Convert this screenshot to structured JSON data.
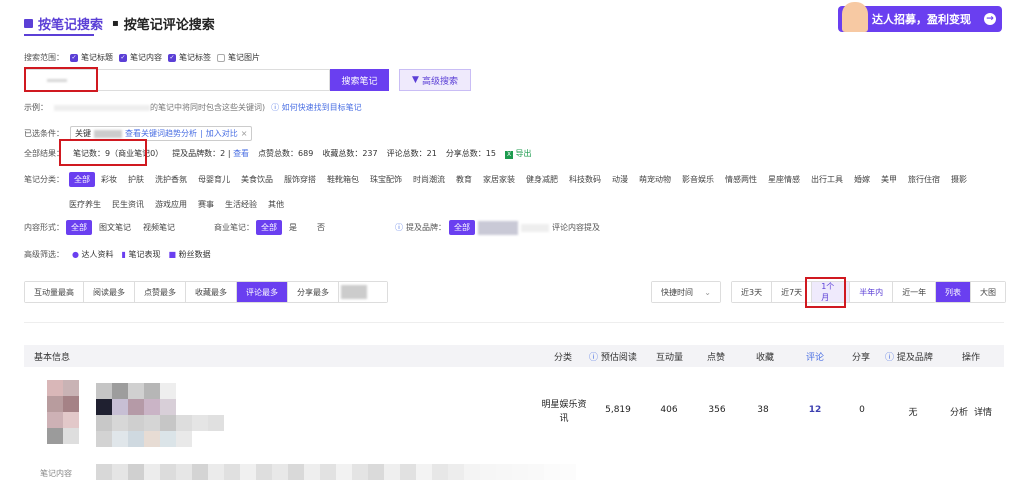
{
  "tabs": [
    {
      "label": "按笔记搜索"
    },
    {
      "label": "按笔记评论搜索"
    }
  ],
  "banner": {
    "label": "达人招募，盈利变现",
    "arrow": "→"
  },
  "scope": {
    "label": "搜索范围：",
    "options": [
      {
        "label": "笔记标题",
        "checked": true
      },
      {
        "label": "笔记内容",
        "checked": true
      },
      {
        "label": "笔记标签",
        "checked": true
      },
      {
        "label": "笔记图片",
        "checked": false
      }
    ]
  },
  "search": {
    "value": "",
    "button": "搜索笔记",
    "advanced": "高级搜索"
  },
  "example": {
    "label": "示例：",
    "text": "的笔记中将同时包含这些关键词)",
    "help": "如何快速找到目标笔记"
  },
  "selected": {
    "label": "已选条件：",
    "tag_prefix": "关键",
    "trend": "查看关键词趋势分析",
    "add": "加入对比",
    "close": "×"
  },
  "results": {
    "label": "全部结果：",
    "items": [
      {
        "text": "笔记数：9（商业笔记0）"
      },
      {
        "text": "提及品牌数：2 |"
      },
      {
        "text": "点赞总数：689"
      },
      {
        "text": "收藏总数：237"
      },
      {
        "text": "评论总数：21"
      },
      {
        "text": "分享总数：15"
      }
    ],
    "view": "查看",
    "export": "导出"
  },
  "category": {
    "label": "笔记分类：",
    "items": [
      "全部",
      "彩妆",
      "护肤",
      "洗护香氛",
      "母婴育儿",
      "美食饮品",
      "服饰穿搭",
      "鞋靴箱包",
      "珠宝配饰",
      "时尚潮流",
      "教育",
      "家居家装",
      "健身减肥",
      "科技数码",
      "动漫",
      "萌宠动物",
      "影音娱乐",
      "情感两性",
      "星座情感",
      "出行工具",
      "婚嫁",
      "美甲",
      "旅行住宿",
      "摄影",
      "医疗养生",
      "民生资讯",
      "游戏应用",
      "赛事",
      "生活经验",
      "其他"
    ]
  },
  "content_form": {
    "label": "内容形式：",
    "items": [
      "全部",
      "图文笔记",
      "视频笔记"
    ]
  },
  "business": {
    "label": "商业笔记：",
    "items": [
      "全部",
      "是",
      "否"
    ]
  },
  "brand": {
    "label": "提及品牌：",
    "items": [
      "全部"
    ],
    "extra": "评论内容提及"
  },
  "advanced_filter": {
    "label": "高级筛选：",
    "items": [
      "达人资料",
      "笔记表现",
      "粉丝数据"
    ]
  },
  "sort": {
    "items": [
      "互动量最高",
      "阅读最多",
      "点赞最多",
      "收藏最多",
      "评论最多",
      "分享最多"
    ],
    "active": 4
  },
  "time": {
    "select": "快捷时间",
    "items": [
      "近3天",
      "近7天",
      "1个月",
      "半年内",
      "近一年"
    ],
    "active": 2
  },
  "view_mode": {
    "items": [
      "列表",
      "大图"
    ],
    "active": 0
  },
  "table": {
    "headers": [
      "基本信息",
      "分类",
      "预估阅读",
      "互动量",
      "点赞",
      "收藏",
      "评论",
      "分享",
      "提及品牌",
      "操作"
    ],
    "rows": [
      {
        "category": "明星娱乐资讯",
        "read": "5,819",
        "interact": "406",
        "likes": "356",
        "fav": "38",
        "comments": "12",
        "shares": "0",
        "brand": "无",
        "actions": [
          "分析",
          "详情"
        ]
      }
    ],
    "next_label": "笔记内容"
  },
  "colors": {
    "accent": "#6a3ff0",
    "highlight": "#d01920",
    "link": "#4a6fe3"
  }
}
